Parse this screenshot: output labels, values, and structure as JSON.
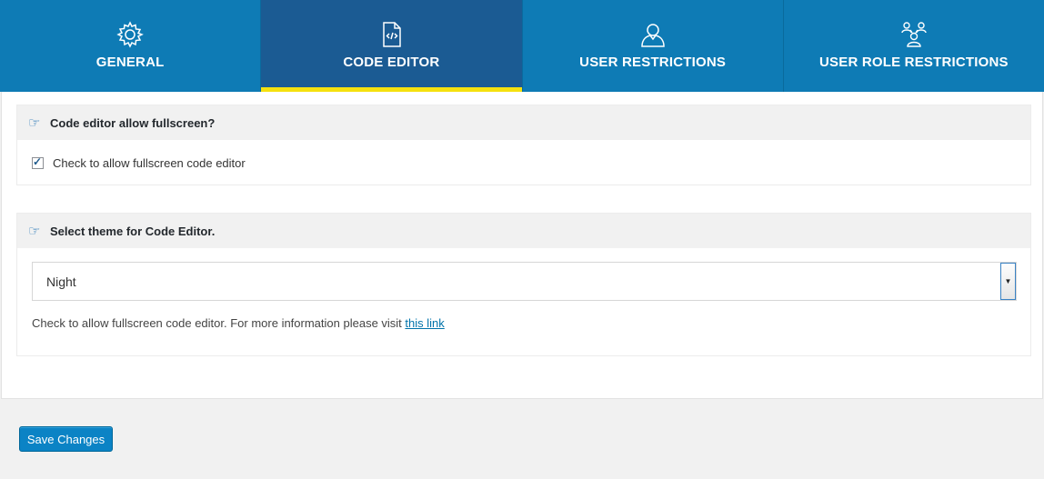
{
  "tabs": [
    {
      "label": "GENERAL",
      "icon": "gear-icon",
      "active": false
    },
    {
      "label": "CODE EDITOR",
      "icon": "code-file-icon",
      "active": true
    },
    {
      "label": "USER RESTRICTIONS",
      "icon": "user-icon",
      "active": false
    },
    {
      "label": "USER ROLE RESTRICTIONS",
      "icon": "users-group-icon",
      "active": false
    }
  ],
  "fullscreen_section": {
    "title": "Code editor allow fullscreen?",
    "checkbox_label": "Check to allow fullscreen code editor",
    "checked": true
  },
  "theme_section": {
    "title": "Select theme for Code Editor.",
    "selected_theme": "Night",
    "help_text": "Check to allow fullscreen code editor. For more information please visit",
    "help_link_text": "this link"
  },
  "save_button_label": "Save Changes",
  "colors": {
    "tab_bar": "#0e7bb5",
    "tab_active": "#1b5b93",
    "tab_active_underline": "#f5e10f",
    "button": "#0b83c5"
  }
}
